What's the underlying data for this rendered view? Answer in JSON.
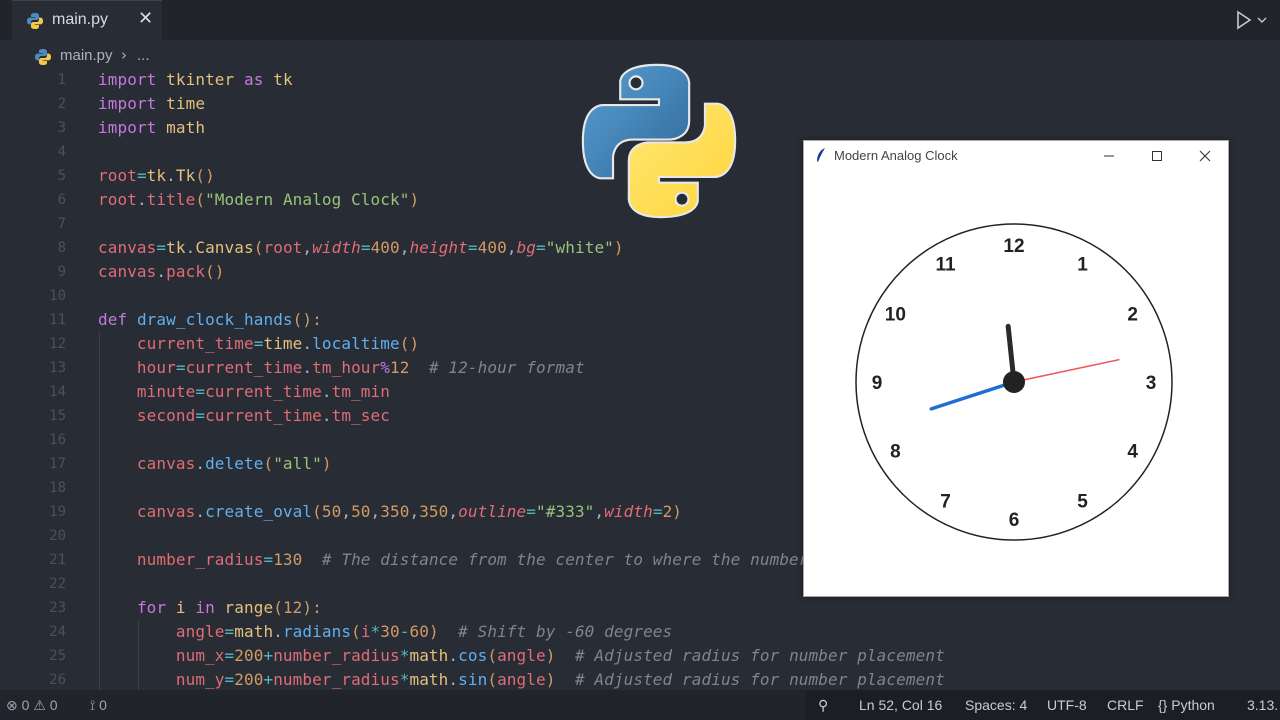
{
  "tab": {
    "file_name": "main.py",
    "close_glyph": "✕"
  },
  "breadcrumb": {
    "file": "main.py",
    "separator": "›",
    "more": "..."
  },
  "editor": {
    "lines": [
      {
        "n": "1",
        "tokens": [
          [
            "import",
            "k"
          ],
          [
            " tkinter ",
            "v"
          ],
          [
            "as",
            "k"
          ],
          [
            " tk",
            "v"
          ]
        ]
      },
      {
        "n": "2",
        "tokens": [
          [
            "import",
            "k"
          ],
          [
            " time",
            "v"
          ]
        ]
      },
      {
        "n": "3",
        "tokens": [
          [
            "import",
            "k"
          ],
          [
            " math",
            "v"
          ]
        ]
      },
      {
        "n": "4",
        "tokens": []
      },
      {
        "n": "5",
        "tokens": [
          [
            "root",
            "r"
          ],
          [
            "=",
            "o"
          ],
          [
            "tk",
            "v"
          ],
          [
            ".",
            "p"
          ],
          [
            "Tk",
            "v"
          ],
          [
            "()",
            "y"
          ]
        ]
      },
      {
        "n": "6",
        "tokens": [
          [
            "root",
            "r"
          ],
          [
            ".",
            "p"
          ],
          [
            "title",
            "r"
          ],
          [
            "(",
            "y"
          ],
          [
            "\"Modern Analog Clock\"",
            "s"
          ],
          [
            ")",
            "y"
          ]
        ]
      },
      {
        "n": "7",
        "tokens": []
      },
      {
        "n": "8",
        "tokens": [
          [
            "canvas",
            "r"
          ],
          [
            "=",
            "o"
          ],
          [
            "tk",
            "v"
          ],
          [
            ".",
            "p"
          ],
          [
            "Canvas",
            "v"
          ],
          [
            "(",
            "y"
          ],
          [
            "root",
            "r"
          ],
          [
            ",",
            "p"
          ],
          [
            "width",
            "pi"
          ],
          [
            "=",
            "o"
          ],
          [
            "400",
            "n"
          ],
          [
            ",",
            "p"
          ],
          [
            "height",
            "pi"
          ],
          [
            "=",
            "o"
          ],
          [
            "400",
            "n"
          ],
          [
            ",",
            "p"
          ],
          [
            "bg",
            "pi"
          ],
          [
            "=",
            "o"
          ],
          [
            "\"white\"",
            "s"
          ],
          [
            ")",
            "y"
          ]
        ]
      },
      {
        "n": "9",
        "tokens": [
          [
            "canvas",
            "r"
          ],
          [
            ".",
            "p"
          ],
          [
            "pack",
            "r"
          ],
          [
            "()",
            "y"
          ]
        ]
      },
      {
        "n": "10",
        "tokens": []
      },
      {
        "n": "11",
        "tokens": [
          [
            "def",
            "k"
          ],
          [
            " ",
            "p"
          ],
          [
            "draw_clock_hands",
            "f"
          ],
          [
            "():",
            "y"
          ]
        ]
      },
      {
        "n": "12",
        "tokens": [
          [
            "    current_time",
            "r"
          ],
          [
            "=",
            "o"
          ],
          [
            "time",
            "v"
          ],
          [
            ".",
            "p"
          ],
          [
            "localtime",
            "f"
          ],
          [
            "()",
            "y"
          ]
        ]
      },
      {
        "n": "13",
        "tokens": [
          [
            "    hour",
            "r"
          ],
          [
            "=",
            "o"
          ],
          [
            "current_time",
            "r"
          ],
          [
            ".",
            "p"
          ],
          [
            "tm_hour",
            "r"
          ],
          [
            "%",
            "k"
          ],
          [
            "12",
            "n"
          ],
          [
            "  # 12-hour format",
            "c"
          ]
        ]
      },
      {
        "n": "14",
        "tokens": [
          [
            "    minute",
            "r"
          ],
          [
            "=",
            "o"
          ],
          [
            "current_time",
            "r"
          ],
          [
            ".",
            "p"
          ],
          [
            "tm_min",
            "r"
          ]
        ]
      },
      {
        "n": "15",
        "tokens": [
          [
            "    second",
            "r"
          ],
          [
            "=",
            "o"
          ],
          [
            "current_time",
            "r"
          ],
          [
            ".",
            "p"
          ],
          [
            "tm_sec",
            "r"
          ]
        ]
      },
      {
        "n": "16",
        "tokens": []
      },
      {
        "n": "17",
        "tokens": [
          [
            "    canvas",
            "r"
          ],
          [
            ".",
            "p"
          ],
          [
            "delete",
            "f"
          ],
          [
            "(",
            "y"
          ],
          [
            "\"all\"",
            "s"
          ],
          [
            ")",
            "y"
          ]
        ]
      },
      {
        "n": "18",
        "tokens": []
      },
      {
        "n": "19",
        "tokens": [
          [
            "    canvas",
            "r"
          ],
          [
            ".",
            "p"
          ],
          [
            "create_oval",
            "f"
          ],
          [
            "(",
            "y"
          ],
          [
            "50",
            "n"
          ],
          [
            ",",
            "p"
          ],
          [
            "50",
            "n"
          ],
          [
            ",",
            "p"
          ],
          [
            "350",
            "n"
          ],
          [
            ",",
            "p"
          ],
          [
            "350",
            "n"
          ],
          [
            ",",
            "p"
          ],
          [
            "outline",
            "pi"
          ],
          [
            "=",
            "o"
          ],
          [
            "\"#333\"",
            "s"
          ],
          [
            ",",
            "p"
          ],
          [
            "width",
            "pi"
          ],
          [
            "=",
            "o"
          ],
          [
            "2",
            "n"
          ],
          [
            ")",
            "y"
          ]
        ]
      },
      {
        "n": "20",
        "tokens": []
      },
      {
        "n": "21",
        "tokens": [
          [
            "    number_radius",
            "r"
          ],
          [
            "=",
            "o"
          ],
          [
            "130",
            "n"
          ],
          [
            "  # The distance from the center to where the numbers",
            "c"
          ]
        ]
      },
      {
        "n": "22",
        "tokens": []
      },
      {
        "n": "23",
        "tokens": [
          [
            "    ",
            "p"
          ],
          [
            "for",
            "k"
          ],
          [
            " i ",
            "v"
          ],
          [
            "in",
            "k"
          ],
          [
            " range",
            "v"
          ],
          [
            "(",
            "y"
          ],
          [
            "12",
            "n"
          ],
          [
            "):",
            "y"
          ]
        ]
      },
      {
        "n": "24",
        "tokens": [
          [
            "        angle",
            "r"
          ],
          [
            "=",
            "o"
          ],
          [
            "math",
            "v"
          ],
          [
            ".",
            "p"
          ],
          [
            "radians",
            "f"
          ],
          [
            "(",
            "y"
          ],
          [
            "i",
            "r"
          ],
          [
            "*",
            "o"
          ],
          [
            "30",
            "n"
          ],
          [
            "-",
            "o"
          ],
          [
            "60",
            "n"
          ],
          [
            ")",
            "y"
          ],
          [
            "  # Shift by -60 degrees",
            "c"
          ]
        ]
      },
      {
        "n": "25",
        "tokens": [
          [
            "        num_x",
            "r"
          ],
          [
            "=",
            "o"
          ],
          [
            "200",
            "n"
          ],
          [
            "+",
            "o"
          ],
          [
            "number_radius",
            "r"
          ],
          [
            "*",
            "o"
          ],
          [
            "math",
            "v"
          ],
          [
            ".",
            "p"
          ],
          [
            "cos",
            "f"
          ],
          [
            "(",
            "y"
          ],
          [
            "angle",
            "r"
          ],
          [
            ")",
            "y"
          ],
          [
            "  # Adjusted radius for number placement",
            "c"
          ]
        ]
      },
      {
        "n": "26",
        "tokens": [
          [
            "        num_y",
            "r"
          ],
          [
            "=",
            "o"
          ],
          [
            "200",
            "n"
          ],
          [
            "+",
            "o"
          ],
          [
            "number_radius",
            "r"
          ],
          [
            "*",
            "o"
          ],
          [
            "math",
            "v"
          ],
          [
            ".",
            "p"
          ],
          [
            "sin",
            "f"
          ],
          [
            "(",
            "y"
          ],
          [
            "angle",
            "r"
          ],
          [
            ")",
            "y"
          ],
          [
            "  # Adjusted radius for number placement",
            "c"
          ]
        ]
      }
    ]
  },
  "colors": {
    "k": "#c678dd",
    "v": "#e5c07b",
    "r": "#e06c75",
    "o": "#56b6c2",
    "p": "#abb2bf",
    "y": "#d19a66",
    "s": "#98c379",
    "n": "#d19a66",
    "pi": "#e06c75",
    "f": "#61afef",
    "c": "#7f848e"
  },
  "tk_window": {
    "title": "Modern Analog Clock",
    "numbers": [
      "12",
      "1",
      "2",
      "3",
      "4",
      "5",
      "6",
      "7",
      "8",
      "9",
      "10",
      "11"
    ],
    "hands": {
      "hour_color": "#2a2a2a",
      "minute_color": "#1f6fd1",
      "second_color": "#f05a5a"
    }
  },
  "statusbar": {
    "errors": "0",
    "warnings": "0",
    "ports": "0",
    "position": "Ln 52, Col 16",
    "spaces": "Spaces: 4",
    "encoding": "UTF-8",
    "eol": "CRLF",
    "language_braces": "{}",
    "language": "Python",
    "version": "3.13."
  }
}
